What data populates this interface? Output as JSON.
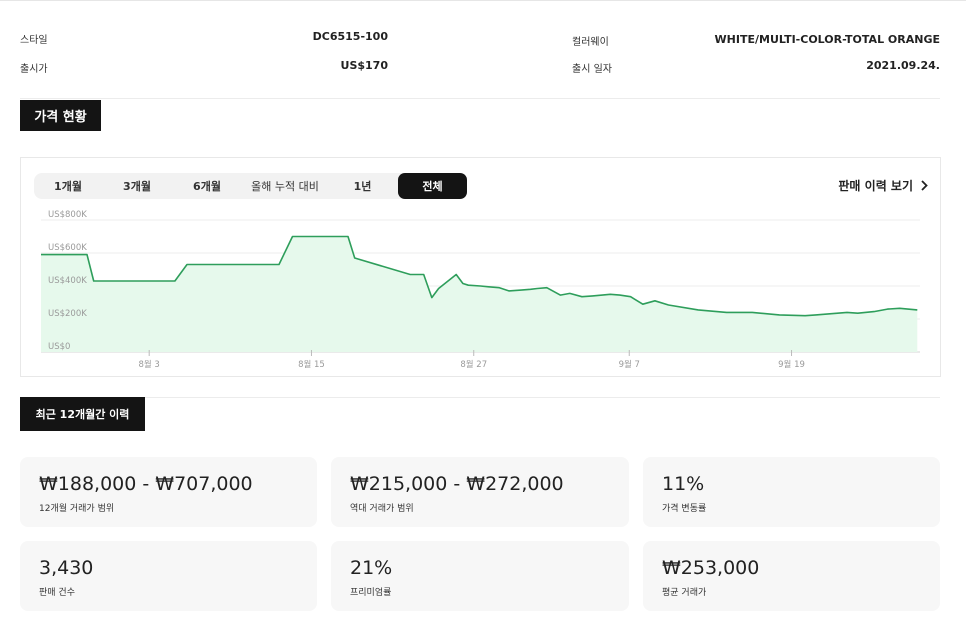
{
  "product_info": {
    "style_label": "스타일",
    "style_value": "DC6515-100",
    "colorway_label": "컬러웨이",
    "colorway_value": "WHITE/MULTI-COLOR-TOTAL ORANGE",
    "release_price_label": "출시가",
    "release_price_value": "US$170",
    "release_date_label": "출시 일자",
    "release_date_value": "2021.09.24."
  },
  "price_section": {
    "title": "가격 현황",
    "tabs": [
      {
        "label": "1개월",
        "active": false
      },
      {
        "label": "3개월",
        "active": false
      },
      {
        "label": "6개월",
        "active": false
      },
      {
        "label": "올해 누적 대비",
        "active": false
      },
      {
        "label": "1년",
        "active": false
      },
      {
        "label": "전체",
        "active": true
      }
    ],
    "history_link": "판매 이력 보기"
  },
  "chart_data": {
    "type": "area",
    "y_tick_labels": [
      "US$800K",
      "US$600K",
      "US$400K",
      "US$200K",
      "US$0"
    ],
    "y_ticks": [
      800,
      600,
      400,
      200,
      0
    ],
    "ylim": [
      0,
      800
    ],
    "x_tick_labels": [
      "8월 3",
      "8월 15",
      "8월 27",
      "9월 7",
      "9월 19"
    ],
    "x_ticks": [
      3,
      15,
      27,
      38.5,
      50.5
    ],
    "xlim": [
      -5,
      60
    ],
    "x_axis_start": "2021-07-27",
    "y_unit": "US$ thousands",
    "grid": true,
    "line_color": "#2e9e5b",
    "fill_color": "#e6f9ec",
    "series": [
      {
        "name": "",
        "x": [
          -5,
          -1.6,
          -1.1,
          4.9,
          5.8,
          12.6,
          13.6,
          17.7,
          18.2,
          22.3,
          23.3,
          23.9,
          24.4,
          25.7,
          26.2,
          26.6,
          27.5,
          28.1,
          28.9,
          29.6,
          30.5,
          31.2,
          31.7,
          32.4,
          33.4,
          34.1,
          35.0,
          35.8,
          36.5,
          37.1,
          37.8,
          38.6,
          39.5,
          40.4,
          41.4,
          43.6,
          45.7,
          47.6,
          49.6,
          51.5,
          52.3,
          53.1,
          54.6,
          55.4,
          56.6,
          57.6,
          58.5,
          59.8
        ],
        "y": [
          590,
          590,
          430,
          430,
          530,
          530,
          700,
          700,
          570,
          470,
          470,
          330,
          385,
          470,
          415,
          405,
          400,
          395,
          390,
          370,
          375,
          380,
          385,
          390,
          345,
          355,
          335,
          340,
          345,
          350,
          345,
          335,
          290,
          310,
          285,
          255,
          240,
          240,
          225,
          220,
          225,
          230,
          240,
          235,
          245,
          260,
          265,
          255
        ]
      }
    ]
  },
  "history_section": {
    "title": "최근 12개월간 이력"
  },
  "stats": [
    {
      "value": "₩188,000 - ₩707,000",
      "label": "12개월 거래가 범위"
    },
    {
      "value": "₩215,000 - ₩272,000",
      "label": "역대 거래가 범위"
    },
    {
      "value": "11%",
      "label": "가격 변동률"
    },
    {
      "value": "3,430",
      "label": "판매 건수"
    },
    {
      "value": "21%",
      "label": "프리미엄률"
    },
    {
      "value": "₩253,000",
      "label": "평균 거래가"
    }
  ]
}
